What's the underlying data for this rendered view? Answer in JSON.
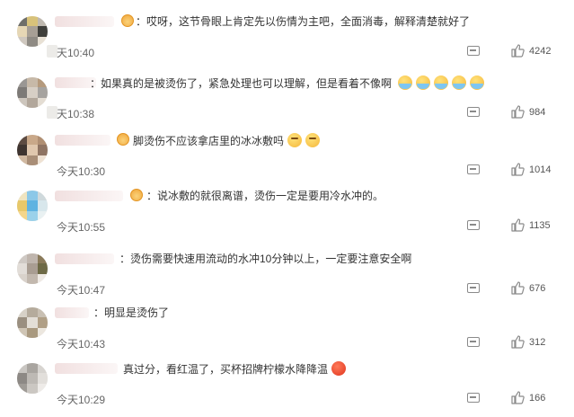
{
  "comments": [
    {
      "text": "：哎呀，这节骨眼上肯定先以伤情为主吧，全面消毒，解释清楚就好了",
      "time": "天10:40",
      "likes": "4242",
      "emojis": [],
      "avatar_colors": [
        "#6f6f6a",
        "#d8c27a",
        "#bfb9b0",
        "#e6d7b5",
        "#a79f95",
        "#3f3f3b",
        "#cfc8bf",
        "#8f8b84",
        "#e8e1d5"
      ]
    },
    {
      "text": "：如果真的是被烫伤了，紧急处理也可以理解，但是看着不像啊",
      "time": "天10:38",
      "likes": "984",
      "emojis": [
        "crying-face",
        "crying-face",
        "crying-face",
        "crying-face",
        "crying-face"
      ],
      "avatar_colors": [
        "#9a9794",
        "#c7b9a8",
        "#b59a7d",
        "#7d7a77",
        "#d7cfc5",
        "#a6a39f",
        "#cdc6bd",
        "#b2a79b",
        "#e4ddd3"
      ]
    },
    {
      "text": "脚烫伤不应该拿店里的冰冰敷吗",
      "time": "今天10:30",
      "likes": "1014",
      "emojis": [
        "thinking-face",
        "thinking-face"
      ],
      "avatar_colors": [
        "#5d4b42",
        "#c9a889",
        "#b08f73",
        "#3e3430",
        "#e0c7ae",
        "#8f7463",
        "#d1b9a1",
        "#a98e77",
        "#efe2d3"
      ]
    },
    {
      "text": "：说冰敷的就很离谱，烫伤一定是要用冷水冲的。",
      "time": "今天10:55",
      "likes": "1135",
      "emojis": [],
      "avatar_colors": [
        "#f0e4bf",
        "#8cc8e8",
        "#cfd9dc",
        "#e7c86a",
        "#5fb3e1",
        "#d8e7ec",
        "#f4d68a",
        "#9ad1ea",
        "#e9f1f2"
      ]
    },
    {
      "text": "：烫伤需要快速用流动的水冲10分钟以上，一定要注意安全啊",
      "time": "今天10:47",
      "likes": "676",
      "emojis": [],
      "avatar_colors": [
        "#cfc9c4",
        "#bfb5ad",
        "#8a7a5a",
        "#e2ddd8",
        "#a99d92",
        "#6e6a46",
        "#d9d2cb",
        "#c2b8ae",
        "#efeae5"
      ]
    },
    {
      "text": "：明显是烫伤了",
      "time": "今天10:43",
      "likes": "312",
      "emojis": [],
      "avatar_colors": [
        "#d7d1c7",
        "#b5ab9c",
        "#c9c0b3",
        "#9a8f80",
        "#e3ded6",
        "#b09f86",
        "#cfc5b5",
        "#a9997f",
        "#ece7df"
      ]
    },
    {
      "text": "真过分，看红温了，买杯招牌柠檬水降降温",
      "time": "今天10:29",
      "likes": "166",
      "emojis": [
        "angry-face"
      ],
      "avatar_colors": [
        "#c9c6c2",
        "#a9a5a0",
        "#d7d4d0",
        "#8d8985",
        "#bdb9b4",
        "#e2dfdb",
        "#9f9b96",
        "#cbc7c2",
        "#eeebe8"
      ]
    }
  ]
}
